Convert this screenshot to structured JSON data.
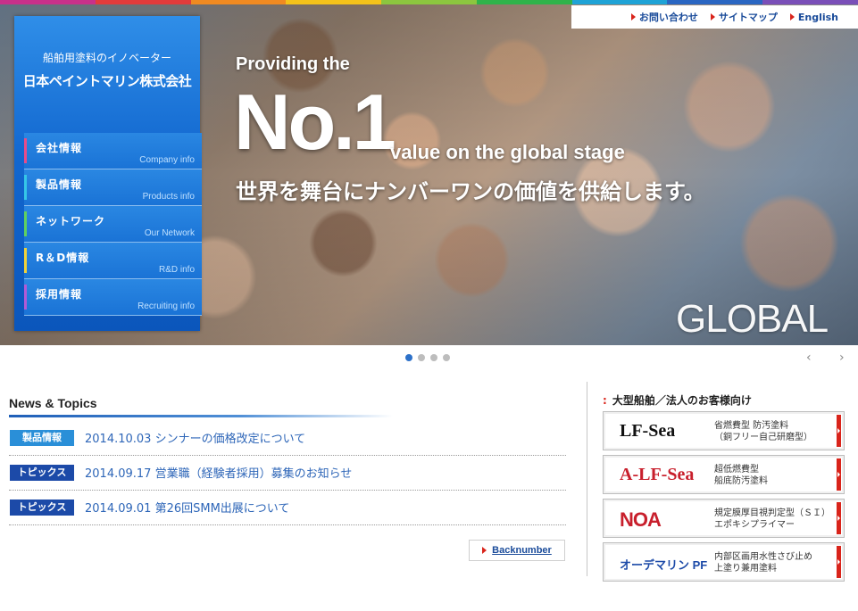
{
  "top_strip_colors": [
    "#c8308a",
    "#e23b3b",
    "#f08a21",
    "#f4c21a",
    "#8cc63f",
    "#2fb34a",
    "#1fa3d6",
    "#2a66c2",
    "#7a4fb8"
  ],
  "util_links": [
    {
      "label": "お問い合わせ"
    },
    {
      "label": "サイトマップ"
    },
    {
      "label": "English"
    }
  ],
  "brand": {
    "tagline": "船舶用塗料のイノベーター",
    "logo_text": "日本ペイントマリン株式会社"
  },
  "nav": [
    {
      "jp": "会社情報",
      "en": "Company info",
      "color": "#e84b8a"
    },
    {
      "jp": "製品情報",
      "en": "Products info",
      "color": "#35c7e8"
    },
    {
      "jp": "ネットワーク",
      "en": "Our Network",
      "color": "#5fd15f"
    },
    {
      "jp": "R＆D情報",
      "en": "R&D info",
      "color": "#f0d23a"
    },
    {
      "jp": "採用情報",
      "en": "Recruiting info",
      "color": "#b25ad6"
    }
  ],
  "hero": {
    "line1": "Providing the",
    "big": "No.1",
    "line2": "value on the global stage",
    "jp": "世界を舞台にナンバーワンの価値を供給します。",
    "watermark": "GLOBAL"
  },
  "slider": {
    "active_index": 0,
    "count": 4
  },
  "news": {
    "title": "News & Topics",
    "items": [
      {
        "badge": "製品情報",
        "badge_color": "#2a8fd8",
        "text": "2014.10.03 シンナーの価格改定について"
      },
      {
        "badge": "トピックス",
        "badge_color": "#1c4aa8",
        "text": "2014.09.17 営業職（経験者採用）募集のお知らせ"
      },
      {
        "badge": "トピックス",
        "badge_color": "#1c4aa8",
        "text": "2014.09.01 第26回SMM出展について"
      }
    ],
    "backnumber": "Backnumber"
  },
  "right": {
    "title": "大型船舶／法人のお客様向け",
    "products": [
      {
        "logo": "LF-Sea",
        "logo_color": "#111111",
        "desc1": "省燃費型 防汚塗料",
        "desc2": "（銅フリー自己研磨型）"
      },
      {
        "logo": "A-LF-Sea",
        "logo_color": "#c81f2c",
        "desc1": "超低燃費型",
        "desc2": "船底防汚塗料"
      },
      {
        "logo": "NOA",
        "logo_color": "#c81f2c",
        "desc1": "規定膜厚目視判定型（ＳＩ）",
        "desc2": "エポキシプライマー"
      },
      {
        "logo": "オーデマリン PF",
        "logo_color": "#1c4aa8",
        "desc1": "内部区画用水性さび止め",
        "desc2": "上塗り兼用塗料"
      }
    ]
  }
}
